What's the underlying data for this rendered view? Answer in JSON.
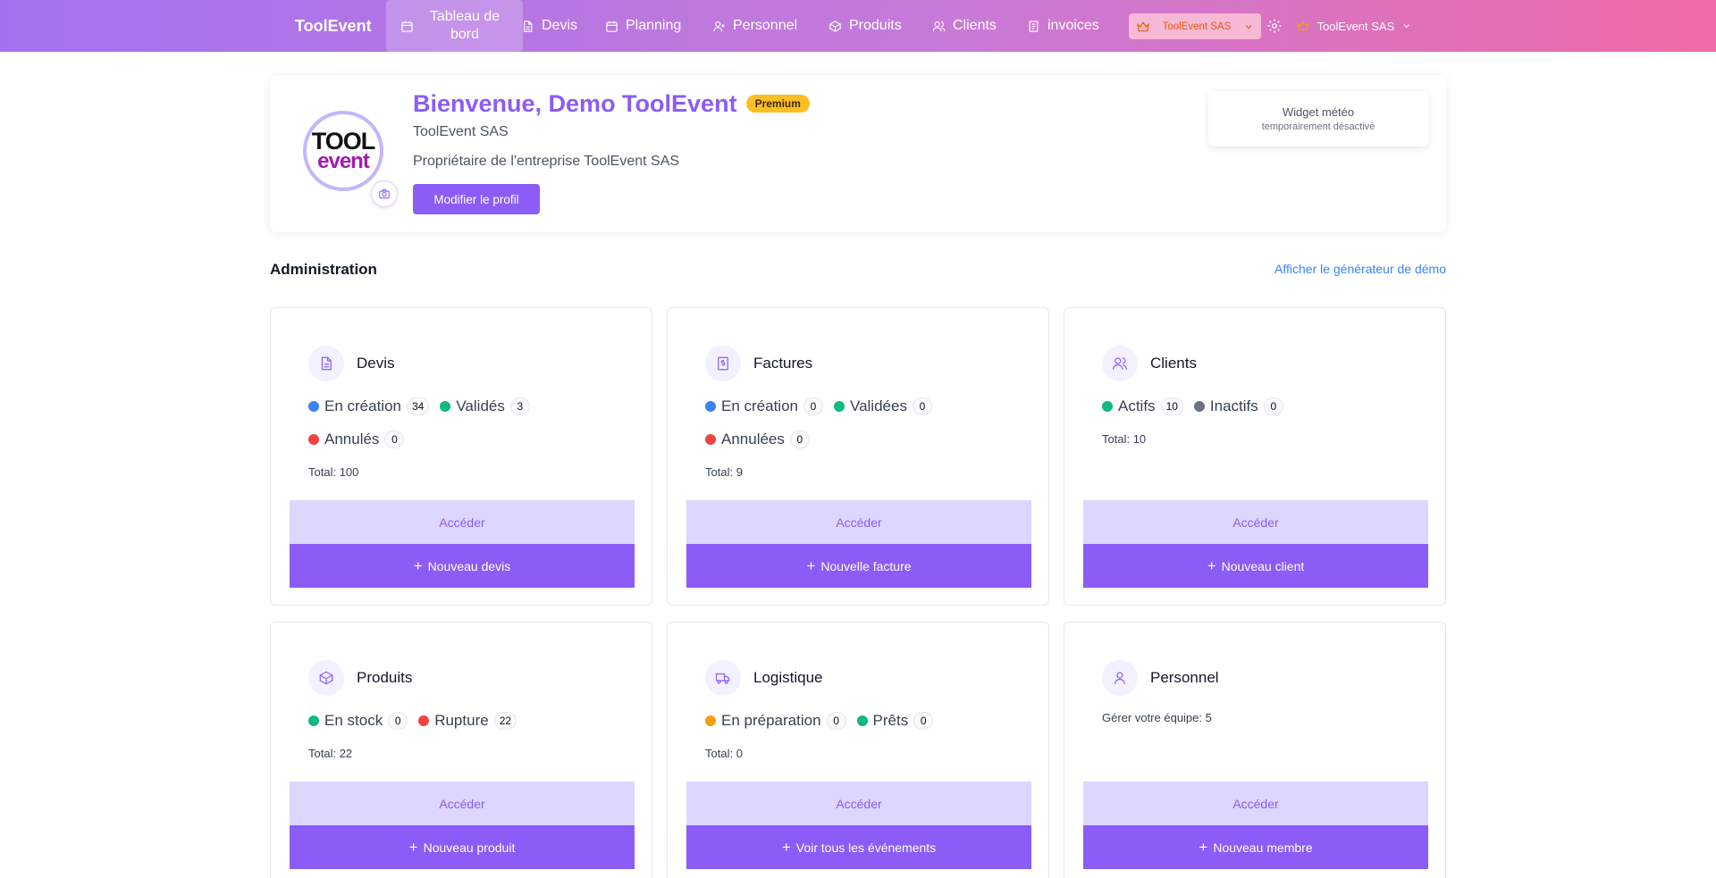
{
  "nav": {
    "brand": "ToolEvent",
    "items": [
      {
        "label": "Tableau de bord",
        "icon": "calendar-icon"
      },
      {
        "label": "Devis",
        "icon": "document-icon"
      },
      {
        "label": "Planning",
        "icon": "calendar-icon"
      },
      {
        "label": "Personnel",
        "icon": "user-icon"
      },
      {
        "label": "Produits",
        "icon": "box-icon"
      },
      {
        "label": "Clients",
        "icon": "users-icon"
      },
      {
        "label": "invoices",
        "icon": "receipt-icon"
      }
    ],
    "org_select": "ToolEvent SAS",
    "user_menu": "ToolEvent SAS"
  },
  "profile": {
    "welcome": "Bienvenue, Demo ToolEvent",
    "badge": "Premium",
    "company": "ToolEvent SAS",
    "role": "Propriétaire de l'entreprise ToolEvent SAS",
    "edit_button": "Modifier le profil",
    "logo_top": "TOOL",
    "logo_bottom": "event",
    "weather_title": "Widget météo",
    "weather_sub": "temporairement désactivé"
  },
  "admin": {
    "title": "Administration",
    "demo_link": "Afficher le générateur de démo"
  },
  "cards": [
    {
      "title": "Devis",
      "stats_row1": [
        {
          "label": "En création",
          "count": "34",
          "color": "#3b82f6"
        },
        {
          "label": "Validés",
          "count": "3",
          "color": "#10b981"
        }
      ],
      "stats_row2": [
        {
          "label": "Annulés",
          "count": "0",
          "color": "#ef4444"
        }
      ],
      "total_label": "Total:",
      "total": "100",
      "access": "Accéder",
      "new": "Nouveau devis"
    },
    {
      "title": "Factures",
      "stats_row1": [
        {
          "label": "En création",
          "count": "0",
          "color": "#3b82f6"
        },
        {
          "label": "Validées",
          "count": "0",
          "color": "#10b981"
        }
      ],
      "stats_row2": [
        {
          "label": "Annulées",
          "count": "0",
          "color": "#ef4444"
        }
      ],
      "total_label": "Total:",
      "total": "9",
      "access": "Accéder",
      "new": "Nouvelle facture"
    },
    {
      "title": "Clients",
      "stats_row1": [
        {
          "label": "Actifs",
          "count": "10",
          "color": "#10b981"
        },
        {
          "label": "Inactifs",
          "count": "0",
          "color": "#6b7280"
        }
      ],
      "total_label": "Total:",
      "total": "10",
      "access": "Accéder",
      "new": "Nouveau client"
    },
    {
      "title": "Produits",
      "stats_row1": [
        {
          "label": "En stock",
          "count": "0",
          "color": "#10b981"
        },
        {
          "label": "Rupture",
          "count": "22",
          "color": "#ef4444"
        }
      ],
      "total_label": "Total:",
      "total": "22",
      "access": "Accéder",
      "new": "Nouveau produit"
    },
    {
      "title": "Logistique",
      "stats_row1": [
        {
          "label": "En préparation",
          "count": "0",
          "color": "#f59e0b"
        },
        {
          "label": "Prêts",
          "count": "0",
          "color": "#10b981"
        }
      ],
      "total_label": "Total:",
      "total": "0",
      "access": "Accéder",
      "new": "Voir tous les événements"
    },
    {
      "title": "Personnel",
      "total_label": "Gérer votre équipe:",
      "total": "5",
      "access": "Accéder",
      "new": "Nouveau membre"
    }
  ]
}
